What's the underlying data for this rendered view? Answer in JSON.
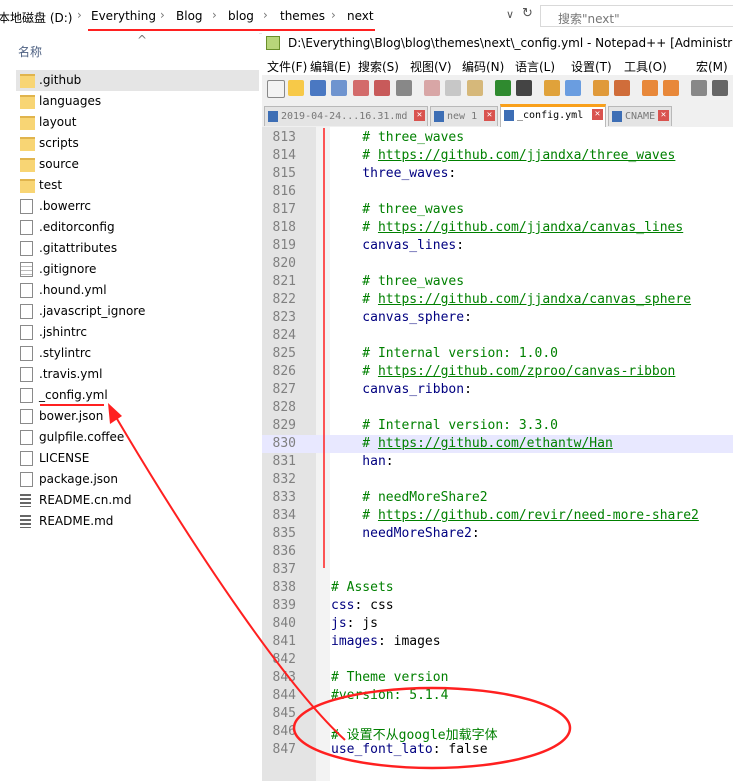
{
  "explorer": {
    "breadcrumb": [
      "本地磁盘 (D:)",
      "Everything",
      "Blog",
      "blog",
      "themes",
      "next"
    ],
    "search_placeholder": "搜索\"next\"",
    "column_header": "名称",
    "files": [
      {
        "name": ".github",
        "type": "folder"
      },
      {
        "name": "languages",
        "type": "folder"
      },
      {
        "name": "layout",
        "type": "folder"
      },
      {
        "name": "scripts",
        "type": "folder"
      },
      {
        "name": "source",
        "type": "folder"
      },
      {
        "name": "test",
        "type": "folder"
      },
      {
        "name": ".bowerrc",
        "type": "file"
      },
      {
        "name": ".editorconfig",
        "type": "file"
      },
      {
        "name": ".gitattributes",
        "type": "file"
      },
      {
        "name": ".gitignore",
        "type": "txt"
      },
      {
        "name": ".hound.yml",
        "type": "file"
      },
      {
        "name": ".javascript_ignore",
        "type": "file"
      },
      {
        "name": ".jshintrc",
        "type": "file"
      },
      {
        "name": ".stylintrc",
        "type": "file"
      },
      {
        "name": ".travis.yml",
        "type": "file"
      },
      {
        "name": "_config.yml",
        "type": "file"
      },
      {
        "name": "bower.json",
        "type": "file"
      },
      {
        "name": "gulpfile.coffee",
        "type": "file"
      },
      {
        "name": "LICENSE",
        "type": "file"
      },
      {
        "name": "package.json",
        "type": "file"
      },
      {
        "name": "README.cn.md",
        "type": "md"
      },
      {
        "name": "README.md",
        "type": "md"
      }
    ]
  },
  "notepad": {
    "title": "D:\\Everything\\Blog\\blog\\themes\\next\\_config.yml - Notepad++ [Administrat",
    "menu": [
      "文件(F)",
      "编辑(E)",
      "搜索(S)",
      "视图(V)",
      "编码(N)",
      "语言(L)",
      "设置(T)",
      "工具(O)",
      "宏(M)"
    ],
    "tabs": [
      {
        "label": "2019-04-24...16.31.md",
        "active": false
      },
      {
        "label": "new 1",
        "active": false
      },
      {
        "label": "_config.yml",
        "active": true
      },
      {
        "label": "CNAME",
        "active": false
      }
    ],
    "lines": [
      {
        "n": "813",
        "parts": [
          {
            "t": "    # three_waves",
            "c": "com"
          }
        ]
      },
      {
        "n": "814",
        "parts": [
          {
            "t": "    # ",
            "c": "com"
          },
          {
            "t": "https://github.com/jjandxa/three_waves",
            "c": "url"
          }
        ]
      },
      {
        "n": "815",
        "parts": [
          {
            "t": "    three_waves",
            "c": "key"
          },
          {
            "t": ":",
            "c": "val"
          }
        ]
      },
      {
        "n": "816",
        "parts": []
      },
      {
        "n": "817",
        "parts": [
          {
            "t": "    # three_waves",
            "c": "com"
          }
        ]
      },
      {
        "n": "818",
        "parts": [
          {
            "t": "    # ",
            "c": "com"
          },
          {
            "t": "https://github.com/jjandxa/canvas_lines",
            "c": "url"
          }
        ]
      },
      {
        "n": "819",
        "parts": [
          {
            "t": "    canvas_lines",
            "c": "key"
          },
          {
            "t": ":",
            "c": "val"
          }
        ]
      },
      {
        "n": "820",
        "parts": []
      },
      {
        "n": "821",
        "parts": [
          {
            "t": "    # three_waves",
            "c": "com"
          }
        ]
      },
      {
        "n": "822",
        "parts": [
          {
            "t": "    # ",
            "c": "com"
          },
          {
            "t": "https://github.com/jjandxa/canvas_sphere",
            "c": "url"
          }
        ]
      },
      {
        "n": "823",
        "parts": [
          {
            "t": "    canvas_sphere",
            "c": "key"
          },
          {
            "t": ":",
            "c": "val"
          }
        ]
      },
      {
        "n": "824",
        "parts": []
      },
      {
        "n": "825",
        "parts": [
          {
            "t": "    # Internal version: 1.0.0",
            "c": "com"
          }
        ]
      },
      {
        "n": "826",
        "parts": [
          {
            "t": "    # ",
            "c": "com"
          },
          {
            "t": "https://github.com/zproo/canvas-ribbon",
            "c": "url"
          }
        ]
      },
      {
        "n": "827",
        "parts": [
          {
            "t": "    canvas_ribbon",
            "c": "key"
          },
          {
            "t": ":",
            "c": "val"
          }
        ]
      },
      {
        "n": "828",
        "parts": []
      },
      {
        "n": "829",
        "parts": [
          {
            "t": "    # Internal version: 3.3.0",
            "c": "com"
          }
        ]
      },
      {
        "n": "830",
        "parts": [
          {
            "t": "    # ",
            "c": "com"
          },
          {
            "t": "https://github.com/ethantw/Han",
            "c": "url"
          }
        ],
        "current": true
      },
      {
        "n": "831",
        "parts": [
          {
            "t": "    han",
            "c": "key"
          },
          {
            "t": ":",
            "c": "val"
          }
        ]
      },
      {
        "n": "832",
        "parts": []
      },
      {
        "n": "833",
        "parts": [
          {
            "t": "    # needMoreShare2",
            "c": "com"
          }
        ]
      },
      {
        "n": "834",
        "parts": [
          {
            "t": "    # ",
            "c": "com"
          },
          {
            "t": "https://github.com/revir/need-more-share2",
            "c": "url"
          }
        ]
      },
      {
        "n": "835",
        "parts": [
          {
            "t": "    needMoreShare2",
            "c": "key"
          },
          {
            "t": ":",
            "c": "val"
          }
        ]
      },
      {
        "n": "836",
        "parts": []
      },
      {
        "n": "837",
        "parts": []
      },
      {
        "n": "838",
        "parts": [
          {
            "t": "# Assets",
            "c": "com"
          }
        ]
      },
      {
        "n": "839",
        "parts": [
          {
            "t": "css",
            "c": "key"
          },
          {
            "t": ": css",
            "c": "val"
          }
        ]
      },
      {
        "n": "840",
        "parts": [
          {
            "t": "js",
            "c": "key"
          },
          {
            "t": ": js",
            "c": "val"
          }
        ]
      },
      {
        "n": "841",
        "parts": [
          {
            "t": "images",
            "c": "key"
          },
          {
            "t": ": images",
            "c": "val"
          }
        ]
      },
      {
        "n": "842",
        "parts": []
      },
      {
        "n": "843",
        "parts": [
          {
            "t": "# Theme version",
            "c": "com"
          }
        ]
      },
      {
        "n": "844",
        "parts": [
          {
            "t": "#version: 5.1.4",
            "c": "com"
          }
        ]
      },
      {
        "n": "845",
        "parts": []
      },
      {
        "n": "846",
        "parts": [
          {
            "t": "# 设置不从google加载字体",
            "c": "com"
          }
        ]
      },
      {
        "n": "847",
        "parts": [
          {
            "t": "use_font_lato",
            "c": "key"
          },
          {
            "t": ": false",
            "c": "val"
          }
        ]
      }
    ]
  },
  "colors": {
    "annotation": "#ff2020",
    "comment": "#008000",
    "key": "#000080",
    "tab_accent": "#f9a01b"
  }
}
